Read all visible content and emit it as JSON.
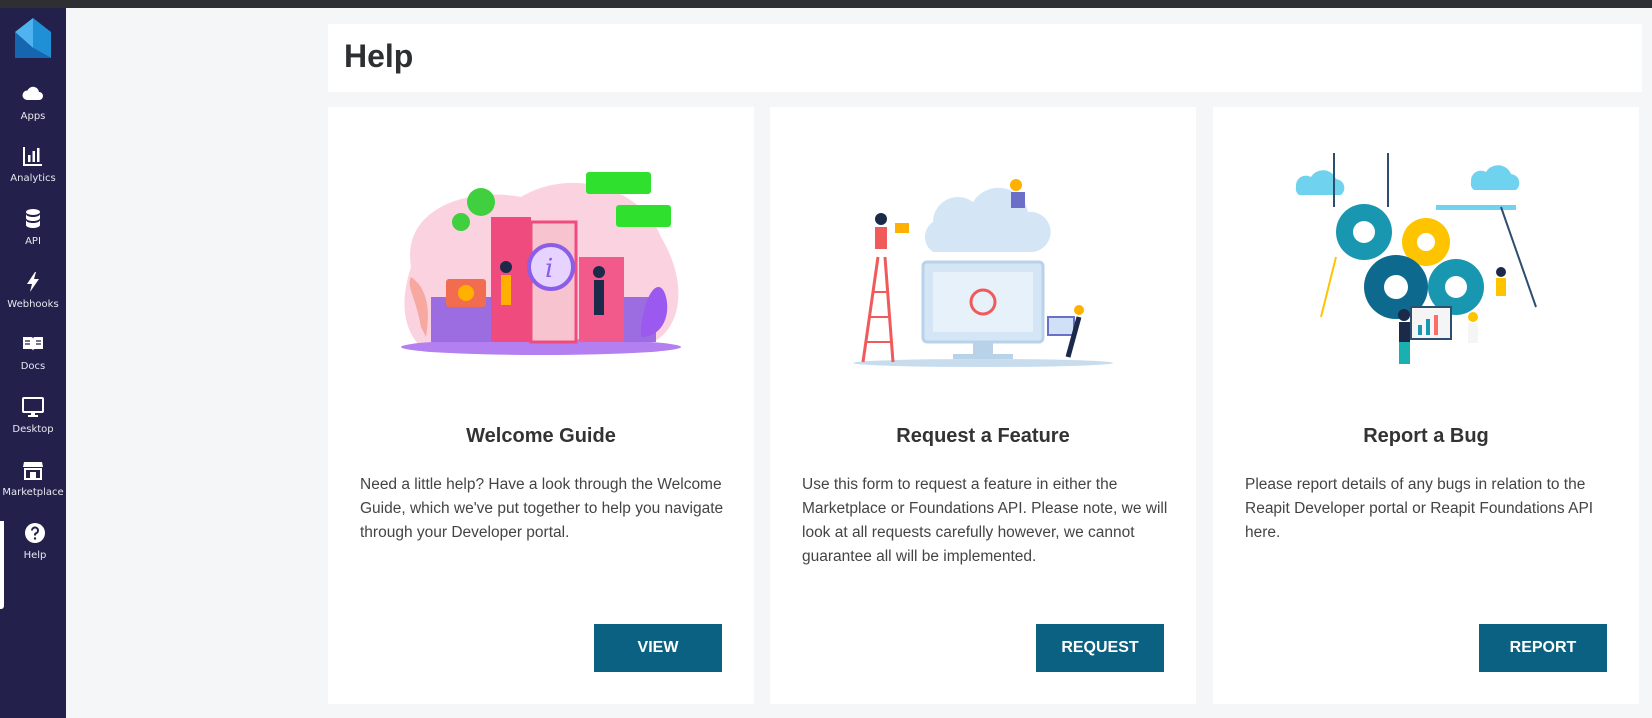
{
  "sidebar": {
    "items": [
      {
        "label": "Apps",
        "icon": "cloud-icon"
      },
      {
        "label": "Analytics",
        "icon": "bar-chart-icon"
      },
      {
        "label": "API",
        "icon": "database-icon"
      },
      {
        "label": "Webhooks",
        "icon": "lightning-icon"
      },
      {
        "label": "Docs",
        "icon": "book-icon"
      },
      {
        "label": "Desktop",
        "icon": "monitor-icon"
      },
      {
        "label": "Marketplace",
        "icon": "store-icon"
      },
      {
        "label": "Help",
        "icon": "question-icon"
      }
    ],
    "active": "Help"
  },
  "header": {
    "title": "Help"
  },
  "cards": [
    {
      "title": "Welcome Guide",
      "text": "Need a little help? Have a look through the Welcome Guide, which we've put together to help you navigate through your Developer portal.",
      "button": "VIEW"
    },
    {
      "title": "Request a Feature",
      "text": "Use this form to request a feature in either the Marketplace or Foundations API. Please note, we will look at all requests carefully however, we cannot guarantee all will be implemented.",
      "button": "REQUEST"
    },
    {
      "title": "Report a Bug",
      "text": "Please report details of any bugs in relation to the Reapit Developer portal or Reapit Foundations API here.",
      "button": "REPORT"
    }
  ],
  "colors": {
    "sidebar": "#23214c",
    "button": "#0b6181",
    "background": "#f5f6f8"
  }
}
